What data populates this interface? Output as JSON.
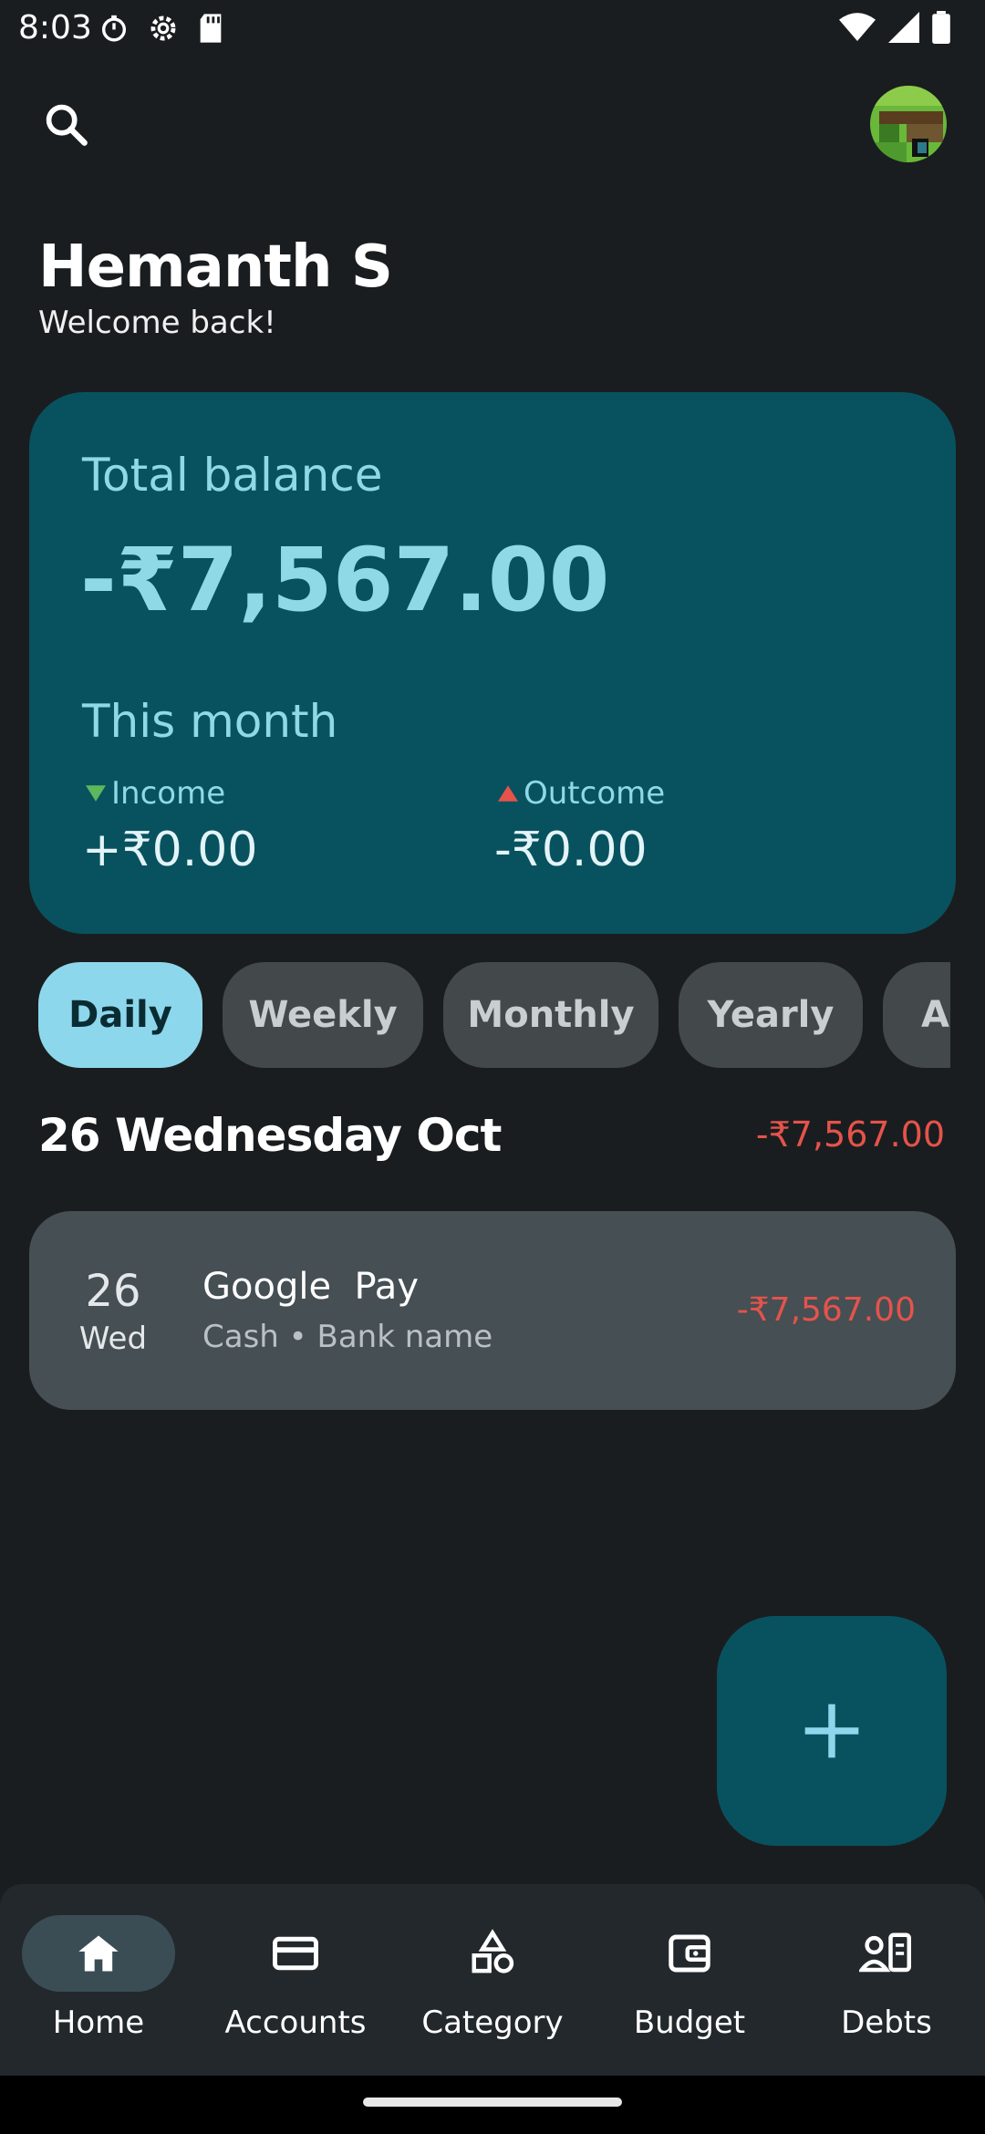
{
  "status_bar": {
    "time": "8:03",
    "left_icons": [
      "timer-icon",
      "settings-icon",
      "sd-card-icon"
    ],
    "right_icons": [
      "wifi-icon",
      "signal-icon",
      "battery-icon"
    ]
  },
  "header": {
    "search_icon": "search-icon",
    "avatar_icon": "avatar"
  },
  "user": {
    "name": "Hemanth S",
    "greeting": "Welcome back!"
  },
  "balance_card": {
    "total_label": "Total balance",
    "total_amount": "-₹7,567.00",
    "period_label": "This month",
    "income_label": "Income",
    "income_value": "+₹0.00",
    "outcome_label": "Outcome",
    "outcome_value": "-₹0.00",
    "income_arrow_color": "#5cb85c",
    "outcome_arrow_color": "#e5534b"
  },
  "filters": {
    "chips": [
      "Daily",
      "Weekly",
      "Monthly",
      "Yearly",
      "All"
    ],
    "selected": "Daily"
  },
  "day_group": {
    "title": "26 Wednesday Oct",
    "total": "-₹7,567.00"
  },
  "transactions": [
    {
      "day": "26",
      "weekday": "Wed",
      "name": "Google  Pay",
      "details": "Cash • Bank name",
      "amount": "-₹7,567.00"
    }
  ],
  "fab": {
    "icon": "plus-icon"
  },
  "bottom_nav": {
    "items": [
      {
        "label": "Home",
        "icon": "home-icon"
      },
      {
        "label": "Accounts",
        "icon": "card-icon"
      },
      {
        "label": "Category",
        "icon": "category-icon"
      },
      {
        "label": "Budget",
        "icon": "wallet-icon"
      },
      {
        "label": "Debts",
        "icon": "debts-icon"
      }
    ],
    "selected": "Home"
  },
  "colors": {
    "background": "#1a1d1f",
    "accent": "#08525f",
    "accent_light": "#8dd7ec",
    "negative": "#e5534b"
  }
}
